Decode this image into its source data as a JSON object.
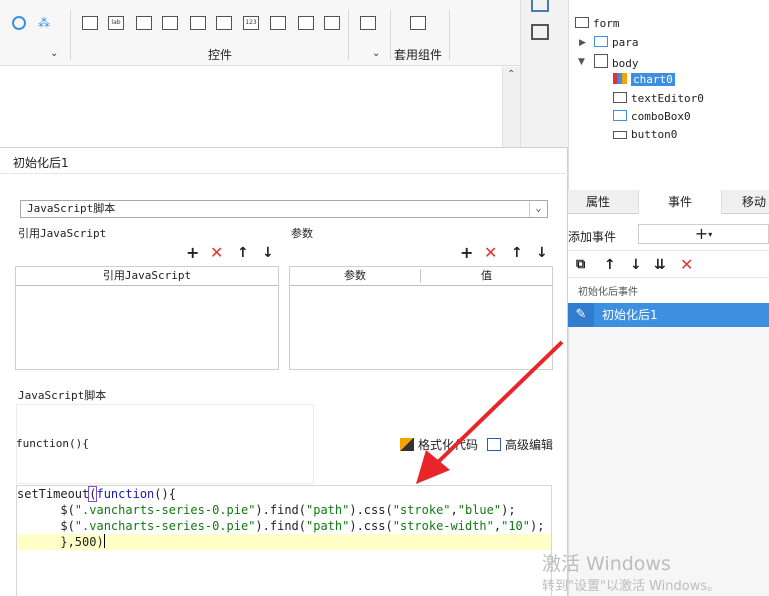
{
  "toolbar": {
    "group_widgets_label": "控件",
    "group_template_label": "套用组件",
    "small_icon_labels": [
      "lab",
      "123"
    ]
  },
  "dialog": {
    "title": "初始化后1",
    "script_type": "JavaScript脚本",
    "ref_js_section": "引用JavaScript",
    "params_section": "参数",
    "ref_js_column": "引用JavaScript",
    "params_columns": [
      "参数",
      "值"
    ],
    "js_section": "JavaScript脚本",
    "function_header": "function(){",
    "format_code_label": "格式化代码",
    "advanced_edit_label": "高级编辑",
    "code_lines": {
      "l1_a": "setTimeout",
      "l1_b": "(",
      "l1_kw": "function",
      "l1_c": "(){",
      "l2_a": "      $(",
      "l2_s1": "\".vancharts-series-0.pie\"",
      "l2_b": ").find(",
      "l2_s2": "\"path\"",
      "l2_c": ").css(",
      "l2_s3": "\"stroke\"",
      "l2_d": ",",
      "l2_s4": "\"blue\"",
      "l2_e": ");",
      "l3_a": "      $(",
      "l3_s1": "\".vancharts-series-0.pie\"",
      "l3_b": ").find(",
      "l3_s2": "\"path\"",
      "l3_c": ").css(",
      "l3_s3": "\"stroke-width\"",
      "l3_d": ",",
      "l3_s4": "\"10\"",
      "l3_e": ");",
      "l4": "      },500)"
    }
  },
  "tree": {
    "root": "form",
    "para": "para",
    "body": "body",
    "children": [
      "chart0",
      "textEditor0",
      "comboBox0",
      "button0"
    ]
  },
  "right_panel": {
    "tabs": [
      "属性",
      "事件",
      "移动"
    ],
    "add_event_label": "添加事件",
    "event_group": "初始化后事件",
    "event_item": "初始化后1"
  },
  "watermark": {
    "line1": "激活 Windows",
    "line2": "转到\"设置\"以激活 Windows。"
  },
  "colors": {
    "accent": "#3d8fe0",
    "delete": "#e03434",
    "arrow": "#e8262a",
    "highlight_line": "#ffffc8"
  }
}
